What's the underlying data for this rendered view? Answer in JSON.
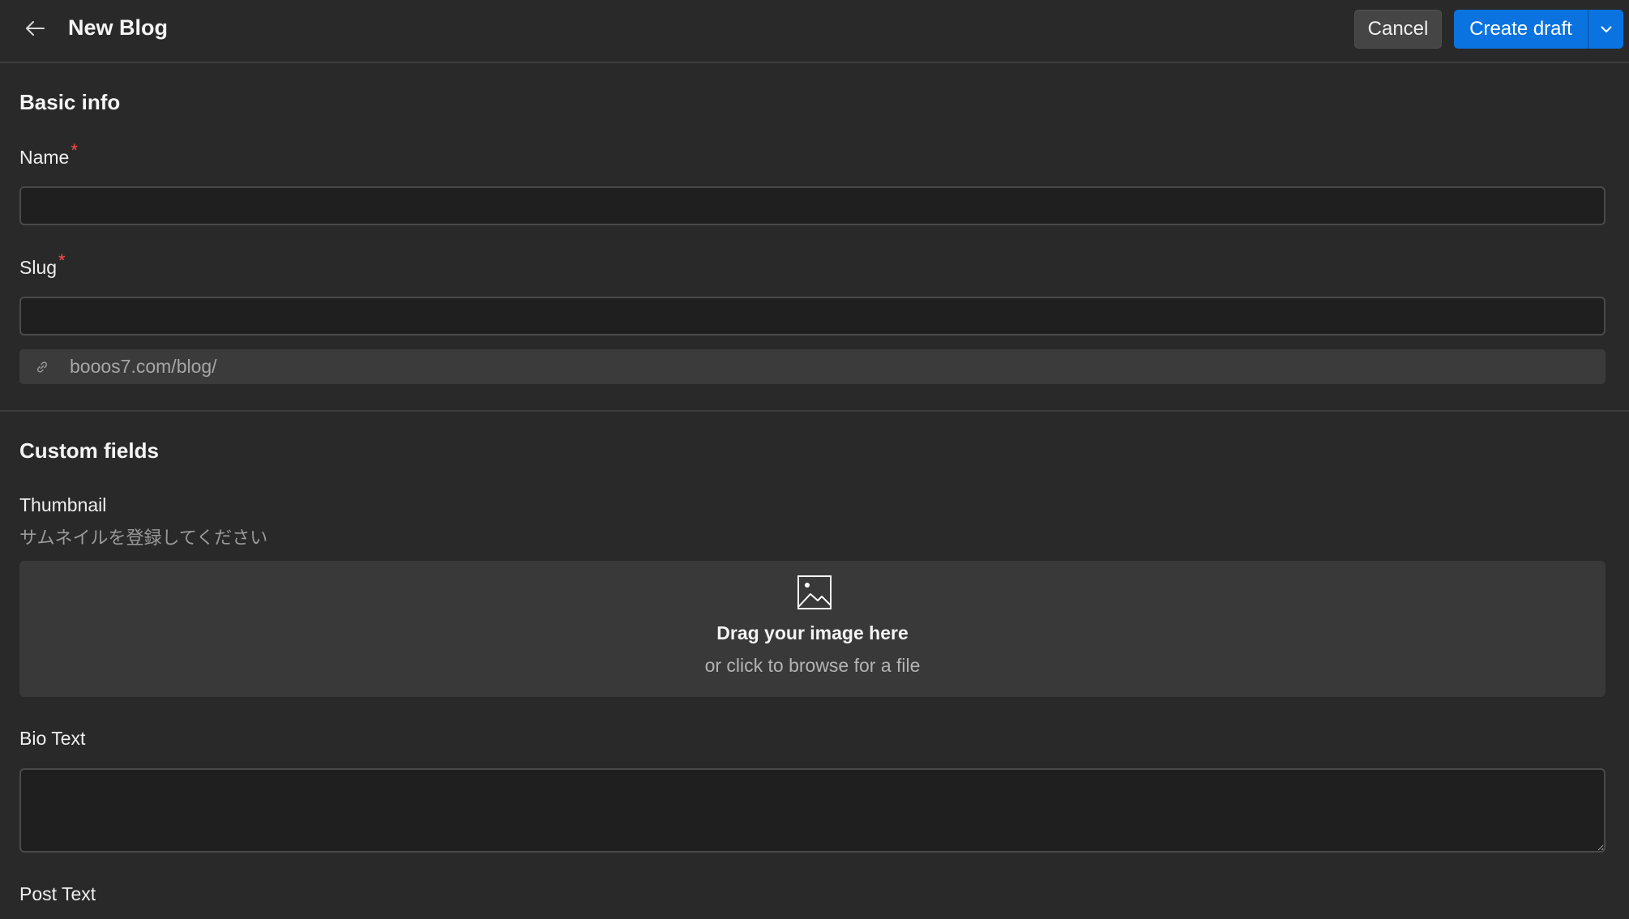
{
  "header": {
    "title": "New Blog",
    "cancel_label": "Cancel",
    "create_label": "Create draft"
  },
  "basic_info": {
    "title": "Basic info",
    "name_label": "Name",
    "name_value": "",
    "slug_label": "Slug",
    "slug_value": "",
    "required_mark": "*",
    "slug_prefix": "booos7.com/blog/"
  },
  "custom_fields": {
    "title": "Custom fields",
    "thumbnail_label": "Thumbnail",
    "thumbnail_hint": "サムネイルを登録してください",
    "dropzone_main": "Drag your image here",
    "dropzone_sub": "or click to browse for a file",
    "bio_label": "Bio Text",
    "bio_value": "",
    "post_label": "Post Text"
  },
  "colors": {
    "background": "#292929",
    "primary": "#0a73e0",
    "required": "#ff4d4d"
  },
  "icons": {
    "back": "arrow-left-icon",
    "chevron": "chevron-down-icon",
    "link": "link-icon",
    "image": "image-icon"
  }
}
